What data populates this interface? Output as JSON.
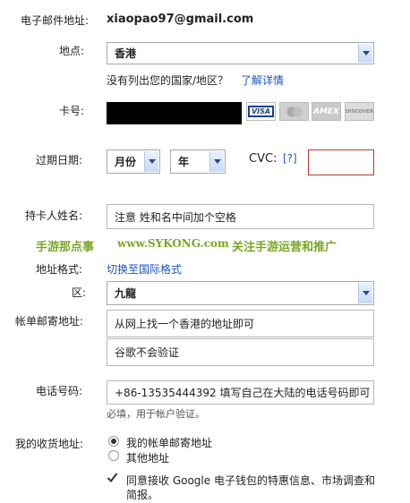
{
  "email": {
    "label": "电子邮件地址:",
    "value": "xiaopao97@gmail.com"
  },
  "location": {
    "label": "地点:",
    "value": "香港",
    "not_listed": "没有列出您的国家/地区？",
    "learn_more": "了解详情"
  },
  "card": {
    "label": "卡号:",
    "brands": [
      "VISA",
      "MasterCard",
      "AMEX",
      "DISCOVER"
    ]
  },
  "expiry": {
    "label": "过期日期:",
    "month": "月份",
    "year": "年",
    "cvc_label": "CVC:",
    "cvc_help": "[?]"
  },
  "cardholder": {
    "label": "持卡人姓名:",
    "value": "注意 姓和名中间加个空格"
  },
  "promo": {
    "left": "手游那点事",
    "center": "www.SYKONG.com",
    "right": "关注手游运营和推广"
  },
  "address_format": {
    "label": "地址格式:",
    "link": "切换至国际格式"
  },
  "district": {
    "label": "区:",
    "value": "九龍"
  },
  "billing_address": {
    "label": "帐单邮寄地址:",
    "line1": "从网上找一个香港的地址即可",
    "line2": "谷歌不会验证"
  },
  "phone": {
    "label": "电话号码:",
    "value": "+86-13535444392 填写自己在大陆的电话号码即可",
    "hint": "必填，用于帐户验证。"
  },
  "shipping": {
    "label": "我的收货地址:",
    "option_billing": "我的帐单邮寄地址",
    "option_other": "其他地址",
    "selected": "我的帐单邮寄地址"
  },
  "consent": {
    "text_line1": "同意接收 Google 电子钱包的特惠信息、市场调查和",
    "text_line2": "简报。",
    "checked": true
  },
  "colors": {
    "link": "#1a56b8",
    "promo": "#7aa625",
    "error_border": "#c0392b"
  }
}
